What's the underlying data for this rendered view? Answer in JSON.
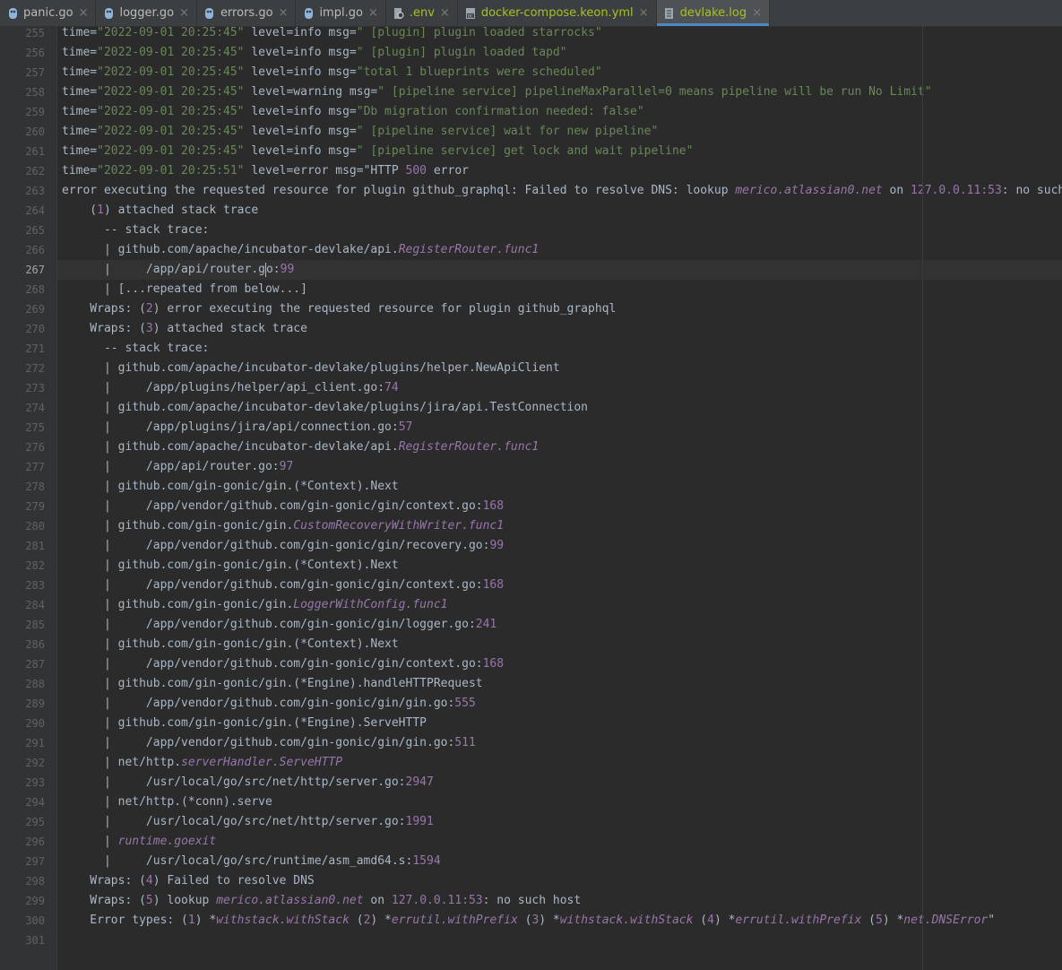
{
  "tabs": [
    {
      "label": "panic.go",
      "icon": "go-file-icon"
    },
    {
      "label": "logger.go",
      "icon": "go-file-icon"
    },
    {
      "label": "errors.go",
      "icon": "go-file-icon"
    },
    {
      "label": "impl.go",
      "icon": "go-file-icon"
    },
    {
      "label": ".env",
      "icon": "env-file-icon"
    },
    {
      "label": "docker-compose.keon.yml",
      "icon": "docker-compose-icon"
    },
    {
      "label": "devlake.log",
      "icon": "log-file-icon",
      "active": true
    }
  ],
  "colors": {
    "accent": "#4a88c7",
    "string": "#6a8759",
    "number": "#9876aa",
    "text": "#a9b7c6",
    "background": "#2b2b2b"
  },
  "current_line": 267,
  "lines": [
    {
      "no": "255",
      "segs": [
        {
          "t": "time="
        },
        {
          "t": "\"2022-09-01 20:25:45\"",
          "c": "s"
        },
        {
          "t": " level=info msg="
        },
        {
          "t": "\" [plugin] plugin loaded starrocks\"",
          "c": "s"
        }
      ]
    },
    {
      "no": "256",
      "segs": [
        {
          "t": "time="
        },
        {
          "t": "\"2022-09-01 20:25:45\"",
          "c": "s"
        },
        {
          "t": " level=info msg="
        },
        {
          "t": "\" [plugin] plugin loaded tapd\"",
          "c": "s"
        }
      ]
    },
    {
      "no": "257",
      "segs": [
        {
          "t": "time="
        },
        {
          "t": "\"2022-09-01 20:25:45\"",
          "c": "s"
        },
        {
          "t": " level=info msg="
        },
        {
          "t": "\"total 1 blueprints were scheduled\"",
          "c": "s"
        }
      ]
    },
    {
      "no": "258",
      "segs": [
        {
          "t": "time="
        },
        {
          "t": "\"2022-09-01 20:25:45\"",
          "c": "s"
        },
        {
          "t": " level=warning msg="
        },
        {
          "t": "\" [pipeline service] pipelineMaxParallel=0 means pipeline will be run No Limit\"",
          "c": "s"
        }
      ]
    },
    {
      "no": "259",
      "segs": [
        {
          "t": "time="
        },
        {
          "t": "\"2022-09-01 20:25:45\"",
          "c": "s"
        },
        {
          "t": " level=info msg="
        },
        {
          "t": "\"Db migration confirmation needed: false\"",
          "c": "s"
        }
      ]
    },
    {
      "no": "260",
      "segs": [
        {
          "t": "time="
        },
        {
          "t": "\"2022-09-01 20:25:45\"",
          "c": "s"
        },
        {
          "t": " level=info msg="
        },
        {
          "t": "\" [pipeline service] wait for new pipeline\"",
          "c": "s"
        }
      ]
    },
    {
      "no": "261",
      "segs": [
        {
          "t": "time="
        },
        {
          "t": "\"2022-09-01 20:25:45\"",
          "c": "s"
        },
        {
          "t": " level=info msg="
        },
        {
          "t": "\" [pipeline service] get lock and wait pipeline\"",
          "c": "s"
        }
      ]
    },
    {
      "no": "262",
      "segs": [
        {
          "t": "time="
        },
        {
          "t": "\"2022-09-01 20:25:51\"",
          "c": "s"
        },
        {
          "t": " level=error msg=\"HTTP "
        },
        {
          "t": "500",
          "c": "n"
        },
        {
          "t": " error"
        }
      ]
    },
    {
      "no": "263",
      "segs": [
        {
          "t": "error executing the requested resource for plugin github_graphql: Failed to resolve DNS: lookup "
        },
        {
          "t": "merico.atlassian0.net",
          "c": "i"
        },
        {
          "t": " on "
        },
        {
          "t": "127.0.0.11:53",
          "c": "n"
        },
        {
          "t": ": no such host"
        }
      ]
    },
    {
      "no": "264",
      "segs": [
        {
          "t": "    ("
        },
        {
          "t": "1",
          "c": "n"
        },
        {
          "t": ") attached stack trace"
        }
      ]
    },
    {
      "no": "265",
      "segs": [
        {
          "t": "      -- stack trace:"
        }
      ]
    },
    {
      "no": "266",
      "segs": [
        {
          "t": "      | github.com/apache/incubator-devlake/api."
        },
        {
          "t": "RegisterRouter.func1",
          "c": "i"
        }
      ]
    },
    {
      "no": "267",
      "segs": [
        {
          "t": "      |     /app/api/router.g"
        },
        {
          "caret": true
        },
        {
          "t": "o:"
        },
        {
          "t": "99",
          "c": "n"
        }
      ]
    },
    {
      "no": "268",
      "segs": [
        {
          "t": "      | [...repeated from below...]"
        }
      ]
    },
    {
      "no": "269",
      "segs": [
        {
          "t": "    Wraps: ("
        },
        {
          "t": "2",
          "c": "n"
        },
        {
          "t": ") error executing the requested resource for plugin github_graphql"
        }
      ]
    },
    {
      "no": "270",
      "segs": [
        {
          "t": "    Wraps: ("
        },
        {
          "t": "3",
          "c": "n"
        },
        {
          "t": ") attached stack trace"
        }
      ]
    },
    {
      "no": "271",
      "segs": [
        {
          "t": "      -- stack trace:"
        }
      ]
    },
    {
      "no": "272",
      "segs": [
        {
          "t": "      | github.com/apache/incubator-devlake/plugins/helper.NewApiClient"
        }
      ]
    },
    {
      "no": "273",
      "segs": [
        {
          "t": "      |     /app/plugins/helper/api_client.go:"
        },
        {
          "t": "74",
          "c": "n"
        }
      ]
    },
    {
      "no": "274",
      "segs": [
        {
          "t": "      | github.com/apache/incubator-devlake/plugins/jira/api.TestConnection"
        }
      ]
    },
    {
      "no": "275",
      "segs": [
        {
          "t": "      |     /app/plugins/jira/api/connection.go:"
        },
        {
          "t": "57",
          "c": "n"
        }
      ]
    },
    {
      "no": "276",
      "segs": [
        {
          "t": "      | github.com/apache/incubator-devlake/api."
        },
        {
          "t": "RegisterRouter.func1",
          "c": "i"
        }
      ]
    },
    {
      "no": "277",
      "segs": [
        {
          "t": "      |     /app/api/router.go:"
        },
        {
          "t": "97",
          "c": "n"
        }
      ]
    },
    {
      "no": "278",
      "segs": [
        {
          "t": "      | github.com/gin-gonic/gin.(*Context).Next"
        }
      ]
    },
    {
      "no": "279",
      "segs": [
        {
          "t": "      |     /app/vendor/github.com/gin-gonic/gin/context.go:"
        },
        {
          "t": "168",
          "c": "n"
        }
      ]
    },
    {
      "no": "280",
      "segs": [
        {
          "t": "      | github.com/gin-gonic/gin."
        },
        {
          "t": "CustomRecoveryWithWriter.func1",
          "c": "i"
        }
      ]
    },
    {
      "no": "281",
      "segs": [
        {
          "t": "      |     /app/vendor/github.com/gin-gonic/gin/recovery.go:"
        },
        {
          "t": "99",
          "c": "n"
        }
      ]
    },
    {
      "no": "282",
      "segs": [
        {
          "t": "      | github.com/gin-gonic/gin.(*Context).Next"
        }
      ]
    },
    {
      "no": "283",
      "segs": [
        {
          "t": "      |     /app/vendor/github.com/gin-gonic/gin/context.go:"
        },
        {
          "t": "168",
          "c": "n"
        }
      ]
    },
    {
      "no": "284",
      "segs": [
        {
          "t": "      | github.com/gin-gonic/gin."
        },
        {
          "t": "LoggerWithConfig.func1",
          "c": "i"
        }
      ]
    },
    {
      "no": "285",
      "segs": [
        {
          "t": "      |     /app/vendor/github.com/gin-gonic/gin/logger.go:"
        },
        {
          "t": "241",
          "c": "n"
        }
      ]
    },
    {
      "no": "286",
      "segs": [
        {
          "t": "      | github.com/gin-gonic/gin.(*Context).Next"
        }
      ]
    },
    {
      "no": "287",
      "segs": [
        {
          "t": "      |     /app/vendor/github.com/gin-gonic/gin/context.go:"
        },
        {
          "t": "168",
          "c": "n"
        }
      ]
    },
    {
      "no": "288",
      "segs": [
        {
          "t": "      | github.com/gin-gonic/gin.(*Engine).handleHTTPRequest"
        }
      ]
    },
    {
      "no": "289",
      "segs": [
        {
          "t": "      |     /app/vendor/github.com/gin-gonic/gin/gin.go:"
        },
        {
          "t": "555",
          "c": "n"
        }
      ]
    },
    {
      "no": "290",
      "segs": [
        {
          "t": "      | github.com/gin-gonic/gin.(*Engine).ServeHTTP"
        }
      ]
    },
    {
      "no": "291",
      "segs": [
        {
          "t": "      |     /app/vendor/github.com/gin-gonic/gin/gin.go:"
        },
        {
          "t": "511",
          "c": "n"
        }
      ]
    },
    {
      "no": "292",
      "segs": [
        {
          "t": "      | net/http."
        },
        {
          "t": "serverHandler.ServeHTTP",
          "c": "i"
        }
      ]
    },
    {
      "no": "293",
      "segs": [
        {
          "t": "      |     /usr/local/go/src/net/http/server.go:"
        },
        {
          "t": "2947",
          "c": "n"
        }
      ]
    },
    {
      "no": "294",
      "segs": [
        {
          "t": "      | net/http.(*conn).serve"
        }
      ]
    },
    {
      "no": "295",
      "segs": [
        {
          "t": "      |     /usr/local/go/src/net/http/server.go:"
        },
        {
          "t": "1991",
          "c": "n"
        }
      ]
    },
    {
      "no": "296",
      "segs": [
        {
          "t": "      | "
        },
        {
          "t": "runtime.goexit",
          "c": "i"
        }
      ]
    },
    {
      "no": "297",
      "segs": [
        {
          "t": "      |     /usr/local/go/src/runtime/asm_amd64.s:"
        },
        {
          "t": "1594",
          "c": "n"
        }
      ]
    },
    {
      "no": "298",
      "segs": [
        {
          "t": "    Wraps: ("
        },
        {
          "t": "4",
          "c": "n"
        },
        {
          "t": ") Failed to resolve DNS"
        }
      ]
    },
    {
      "no": "299",
      "segs": [
        {
          "t": "    Wraps: ("
        },
        {
          "t": "5",
          "c": "n"
        },
        {
          "t": ") lookup "
        },
        {
          "t": "merico.atlassian0.net",
          "c": "i"
        },
        {
          "t": " on "
        },
        {
          "t": "127.0.0.11:53",
          "c": "n"
        },
        {
          "t": ": no such host"
        }
      ]
    },
    {
      "no": "300",
      "segs": [
        {
          "t": "    Error types: ("
        },
        {
          "t": "1",
          "c": "n"
        },
        {
          "t": ") *"
        },
        {
          "t": "withstack.withStack",
          "c": "i"
        },
        {
          "t": " ("
        },
        {
          "t": "2",
          "c": "n"
        },
        {
          "t": ") *"
        },
        {
          "t": "errutil.withPrefix",
          "c": "i"
        },
        {
          "t": " ("
        },
        {
          "t": "3",
          "c": "n"
        },
        {
          "t": ") *"
        },
        {
          "t": "withstack.withStack",
          "c": "i"
        },
        {
          "t": " ("
        },
        {
          "t": "4",
          "c": "n"
        },
        {
          "t": ") *"
        },
        {
          "t": "errutil.withPrefix",
          "c": "i"
        },
        {
          "t": " ("
        },
        {
          "t": "5",
          "c": "n"
        },
        {
          "t": ") *"
        },
        {
          "t": "net.DNSError",
          "c": "i"
        },
        {
          "t": "\""
        }
      ]
    },
    {
      "no": "301",
      "segs": []
    }
  ]
}
